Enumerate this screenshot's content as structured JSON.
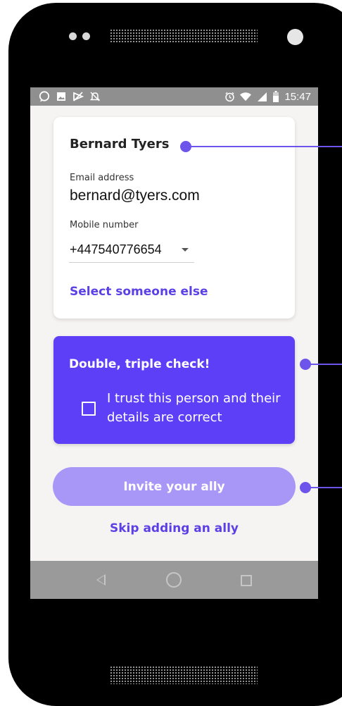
{
  "status_bar": {
    "time": "15:47",
    "icons_left": [
      "chat-bubble-icon",
      "image-icon",
      "mute-flag-icon",
      "notifications-off-icon"
    ],
    "icons_right": [
      "alarm-icon",
      "wifi-icon",
      "signal-icon",
      "battery-icon"
    ]
  },
  "contact_card": {
    "name": "Bernard Tyers",
    "email_label": "Email address",
    "email_value": "bernard@tyers.com",
    "mobile_label": "Mobile number",
    "mobile_value": "+447540776654",
    "select_else_label": "Select someone else"
  },
  "check_panel": {
    "title": "Double, triple check!",
    "checkbox_label": "I trust this person and their details are correct",
    "checked": false
  },
  "actions": {
    "invite_label": "Invite your ally",
    "skip_label": "Skip adding an ally"
  },
  "nav": {
    "icons": [
      "back-icon",
      "home-icon",
      "recent-apps-icon"
    ]
  },
  "colors": {
    "accent": "#5d3ff7",
    "accent_light": "#a897f7",
    "link": "#5b40e6",
    "annotation": "#6d55ec",
    "screen_bg": "#f5f4f2"
  }
}
